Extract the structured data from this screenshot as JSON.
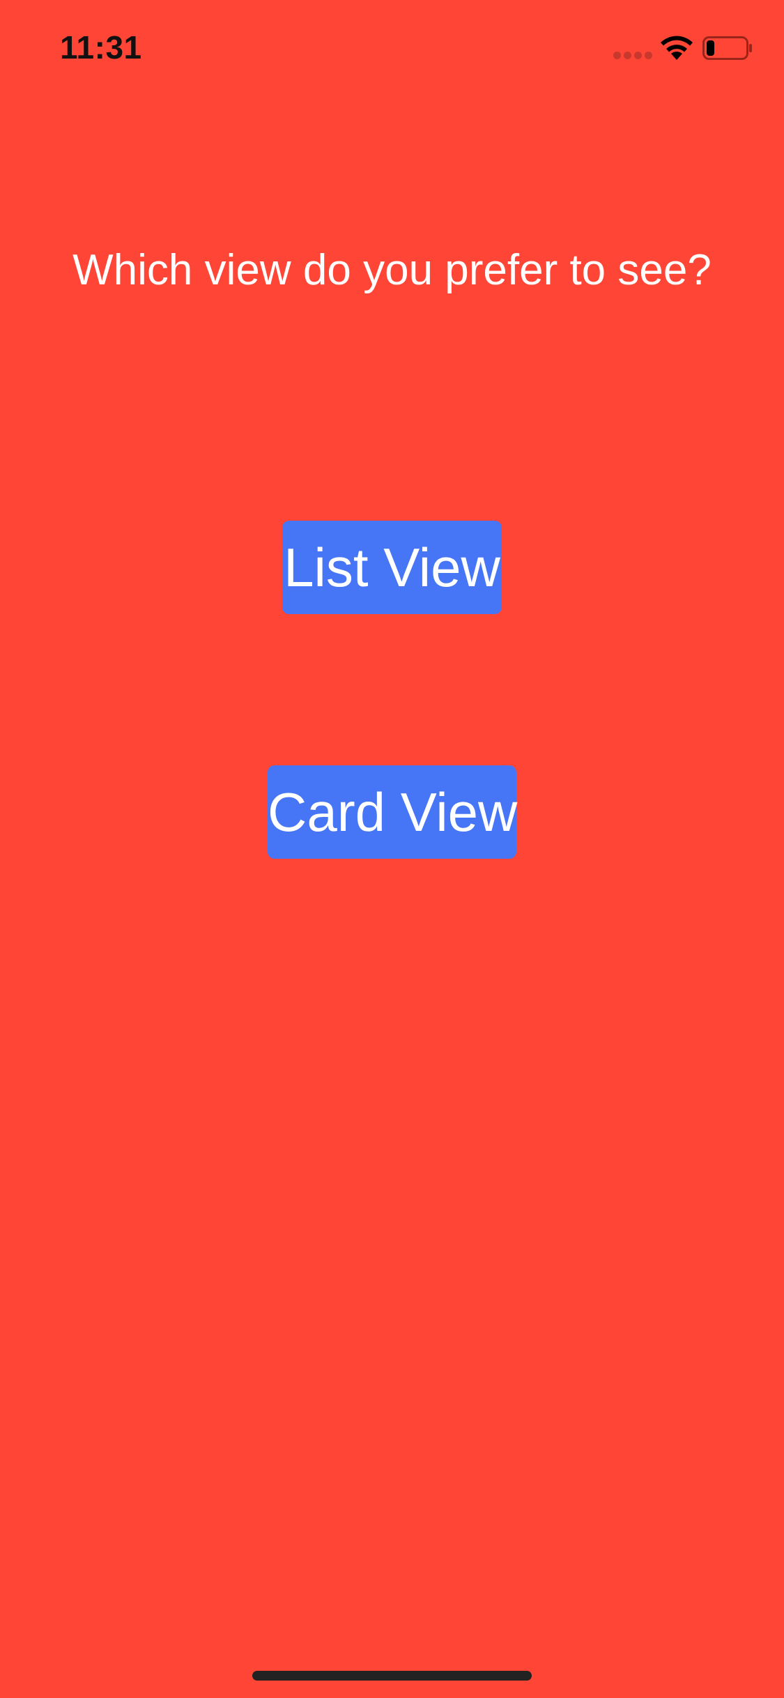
{
  "colors": {
    "background": "#FF4535",
    "button": "#4676F5",
    "button_text": "#FFFFFF",
    "prompt_text": "#FFFFFF",
    "status_text": "#111111",
    "signal_dots": "#C9382C",
    "home_indicator": "#222222"
  },
  "status_bar": {
    "time": "11:31",
    "signal_icon": "signal-dots-icon",
    "wifi_icon": "wifi-icon",
    "battery_icon": "battery-icon",
    "battery_level_percent": 20
  },
  "main": {
    "prompt": "Which view do you prefer to see?",
    "buttons": [
      {
        "label": "List View"
      },
      {
        "label": "Card View"
      }
    ]
  }
}
